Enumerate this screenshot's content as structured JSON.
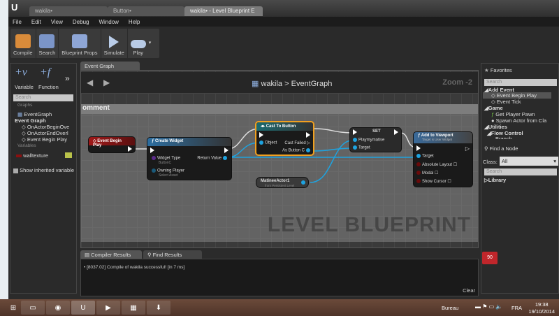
{
  "window": {
    "tabs": [
      "wakila•",
      "Button•",
      "wakila• - Level Blueprint E"
    ]
  },
  "menu": [
    "File",
    "Edit",
    "View",
    "Debug",
    "Window",
    "Help"
  ],
  "toolbar": {
    "compile": "Compile",
    "search": "Search",
    "blueprint_props": "Blueprint Props",
    "simulate": "Simulate",
    "play": "Play"
  },
  "myblueprint": {
    "add_variable": "Variable",
    "add_function": "Function",
    "search_placeholder": "Search",
    "graphs_header": "Graphs",
    "event_graph_item": "EventGraph",
    "event_graph_section": "Event Graph",
    "events": [
      "OnActorBeginOve",
      "OnActorEndOverl",
      "Event Begin Play"
    ],
    "variables_header": "Variables",
    "variable": "walltexture",
    "show_inherited": "Show inherited variable"
  },
  "graph": {
    "tab": "Event Graph",
    "breadcrumb_root": "wakila",
    "breadcrumb_sep": ">",
    "breadcrumb_current": "EventGraph",
    "zoom": "Zoom -2",
    "comment_title": "omment",
    "watermark": "LEVEL BLUEPRINT",
    "nodes": {
      "event_begin_play": {
        "title": "Event Begin Play"
      },
      "create_widget": {
        "title": "Create Widget",
        "widget_type": "Widget Type",
        "widget_type_value": "ButtonC",
        "owning_player": "Owning Player",
        "owning_player_value": "Select Asset",
        "return_value": "Return Value"
      },
      "cast": {
        "title": "Cast To Button",
        "object": "Object",
        "cast_failed": "Cast Failed",
        "as_button": "As Button C"
      },
      "matinee": {
        "title": "MatineeActor1",
        "subtitle": "from Persistent Level"
      },
      "set": {
        "title": "SET",
        "var": "Playmymatise",
        "target": "Target"
      },
      "add_viewport": {
        "title": "Add to Viewport",
        "subtitle": "Target is User Widget",
        "target": "Target",
        "absolute": "Absolute Layout",
        "modal": "Modal",
        "cursor": "Show Cursor"
      }
    }
  },
  "bottom": {
    "tabs": [
      "Compiler Results",
      "Find Results"
    ],
    "log": "[8037.02] Compile of wakila successful! [in 7 ms]",
    "clear": "Clear"
  },
  "palette": {
    "title": "Favorites",
    "search_placeholder": "Search",
    "items": [
      "Add Event",
      "Event Begin Play",
      "Event Tick",
      "Game",
      "Get Player Pawn",
      "Spawn Actor from Cla",
      "Utilities",
      "Flow Control",
      "Branch"
    ],
    "find_node": "Find a Node",
    "class_label": "Class:",
    "class_value": "All",
    "library": "Library"
  },
  "badge": "90",
  "taskbar": {
    "desktop": "Bureau",
    "lang": "FRA",
    "time": "19:38",
    "date": "19/10/2014"
  }
}
